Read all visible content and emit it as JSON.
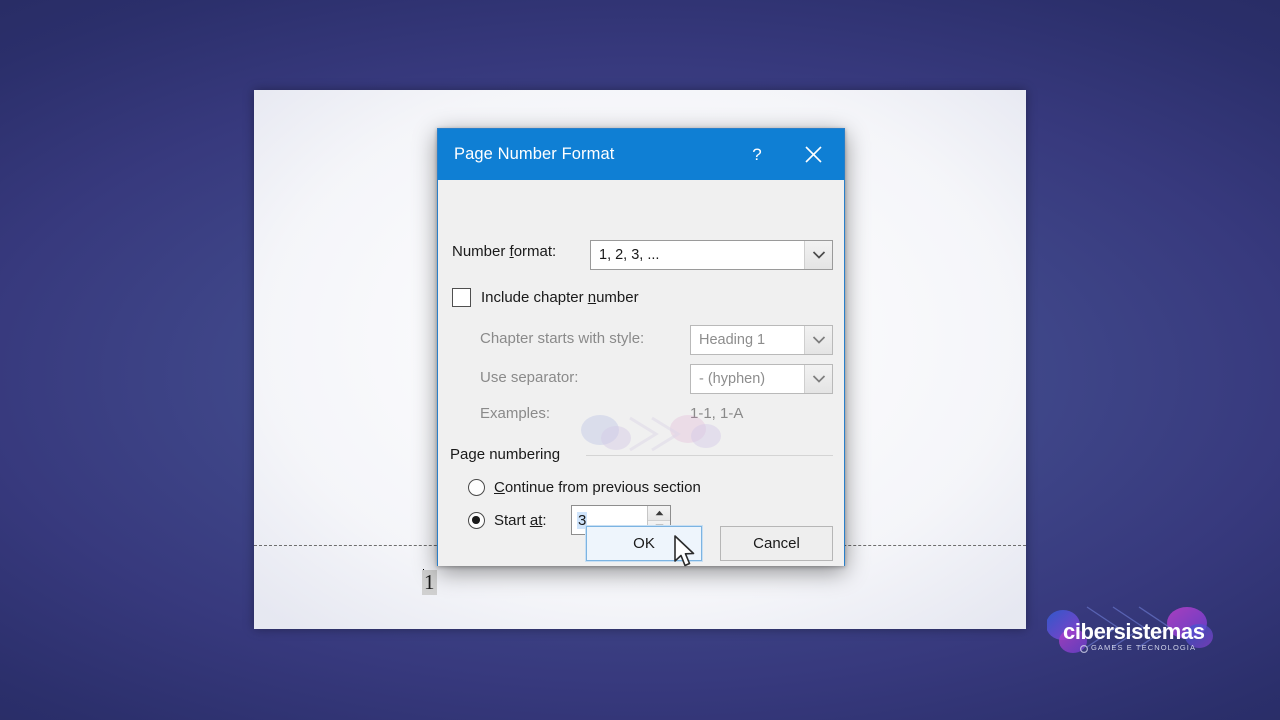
{
  "dialog": {
    "title": "Page Number Format",
    "help_icon": "?",
    "close_icon": "close-icon",
    "number_format": {
      "label_pre": "Number ",
      "label_accel": "f",
      "label_post": "ormat:",
      "value": "1, 2, 3, ..."
    },
    "include_chapter": {
      "label_pre": "Include chapter ",
      "label_accel": "n",
      "label_post": "umber",
      "checked": false
    },
    "chapter_style": {
      "label": "Chapter starts with style:",
      "value": "Heading 1",
      "enabled": false
    },
    "separator": {
      "label": "Use separator:",
      "value": "-   (hyphen)",
      "enabled": false
    },
    "examples": {
      "label": "Examples:",
      "value": "1-1, 1-A"
    },
    "page_numbering": {
      "group_label": "Page numbering",
      "continue_option": {
        "label_pre": "",
        "label_accel": "C",
        "label_post": "ontinue from previous section",
        "selected": false
      },
      "start_at_option": {
        "label_pre": "Start ",
        "label_accel": "at",
        "label_post": ":",
        "selected": true,
        "value": "3"
      }
    },
    "buttons": {
      "ok": "OK",
      "cancel": "Cancel"
    },
    "colors": {
      "title_bar": "#0f7fd4",
      "body": "#f0f0f0",
      "focus_border": "#7cb4e2",
      "selection_highlight": "#cfe4fb"
    }
  },
  "document": {
    "footer_page_number": "1"
  },
  "brand": {
    "name": "cibersistemas",
    "tagline": "GAMES E TECNOLOGIA"
  },
  "cursor": {
    "type": "arrow-pointer"
  }
}
